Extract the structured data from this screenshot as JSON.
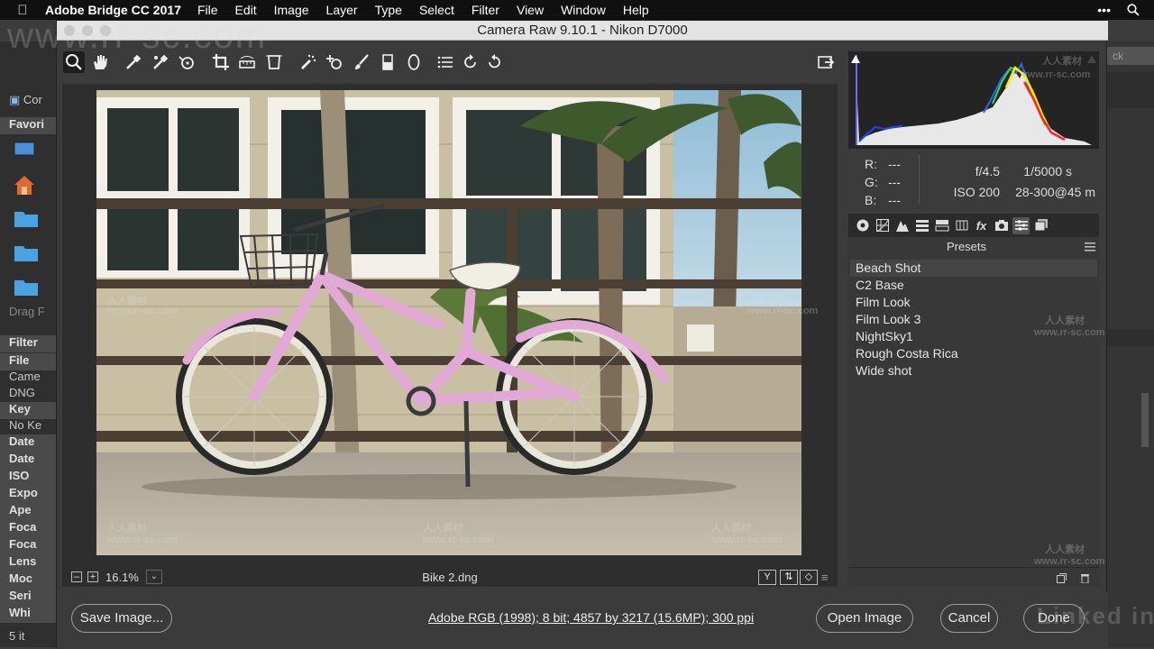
{
  "menubar": {
    "app_name": "Adobe Bridge CC 2017",
    "menus": [
      "File",
      "Edit",
      "Image",
      "Layer",
      "Type",
      "Select",
      "Filter",
      "View",
      "Window",
      "Help"
    ]
  },
  "bridge": {
    "left_items": {
      "computer": "Cor",
      "favorites": "Favori",
      "drag": "Drag F",
      "filter": "Filter",
      "file": "File",
      "camera": "Came",
      "dng": "DNG",
      "keywords": "Key",
      "no_keywords": "No Ke",
      "date1": "Date",
      "date2": "Date",
      "iso": "ISO",
      "exposure": "Expo",
      "aperture": "Ape",
      "focal1": "Foca",
      "focal2": "Foca",
      "lens": "Lens",
      "model": "Moc",
      "serial": "Seri",
      "white": "Whi",
      "count": "5 it"
    },
    "right_search": "ck"
  },
  "dialog": {
    "title": "Camera Raw 9.10.1  -  Nikon D7000",
    "zoom": "16.1%",
    "filename": "Bike 2.dng",
    "view_buttons": [
      "Y",
      "⇅",
      "◇"
    ],
    "info": {
      "r_label": "R:",
      "g_label": "G:",
      "b_label": "B:",
      "r_value": "---",
      "g_value": "---",
      "b_value": "---",
      "aperture": "f/4.5",
      "shutter": "1/5000 s",
      "iso": "ISO 200",
      "lens": "28-300@45 m"
    },
    "presets_title": "Presets",
    "presets": [
      "Beach Shot",
      "C2 Base",
      "Film Look",
      "Film Look 3",
      "NightSky1",
      "Rough Costa Rica",
      "Wide shot"
    ],
    "buttons": {
      "save": "Save Image...",
      "open": "Open Image",
      "cancel": "Cancel",
      "done": "Done"
    },
    "workflow": "Adobe RGB (1998); 8 bit; 4857 by 3217 (15.6MP); 300 ppi"
  },
  "watermarks": {
    "site": "www.rr-sc.com",
    "cn": "人人素材",
    "brand": "Linked in"
  },
  "colors": {
    "bike": "#e3a9d6",
    "accent": "#ffffff"
  }
}
